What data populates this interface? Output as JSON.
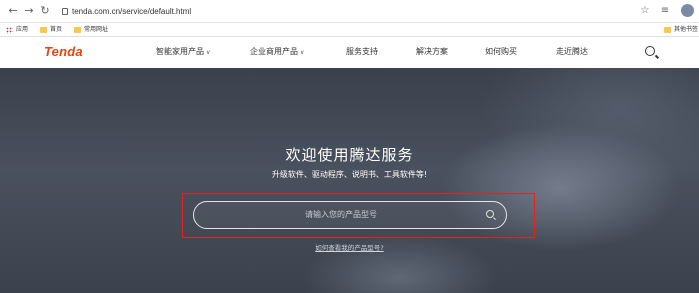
{
  "browser": {
    "url": "tenda.com.cn/service/default.html",
    "bookmarks": [
      {
        "label": "应用"
      },
      {
        "label": "首页"
      },
      {
        "label": "常用网址"
      }
    ],
    "right_bookmark": "其他书签"
  },
  "site": {
    "logo": "Tenda",
    "nav": [
      {
        "label": "智能家用产品",
        "has_dropdown": true
      },
      {
        "label": "企业商用产品",
        "has_dropdown": true
      },
      {
        "label": "服务支持",
        "has_dropdown": false
      },
      {
        "label": "解决方案",
        "has_dropdown": false
      },
      {
        "label": "如何购买",
        "has_dropdown": false
      },
      {
        "label": "走近腾达",
        "has_dropdown": false
      }
    ],
    "caret": "∨"
  },
  "hero": {
    "title": "欢迎使用腾达服务",
    "subtitle": "升级软件、驱动程序、说明书、工具软件等!",
    "search_placeholder": "请输入您的产品型号",
    "help_link": "如何查看我的产品型号?"
  },
  "colors": {
    "brand": "#e8420c",
    "highlight": "#e02424"
  }
}
